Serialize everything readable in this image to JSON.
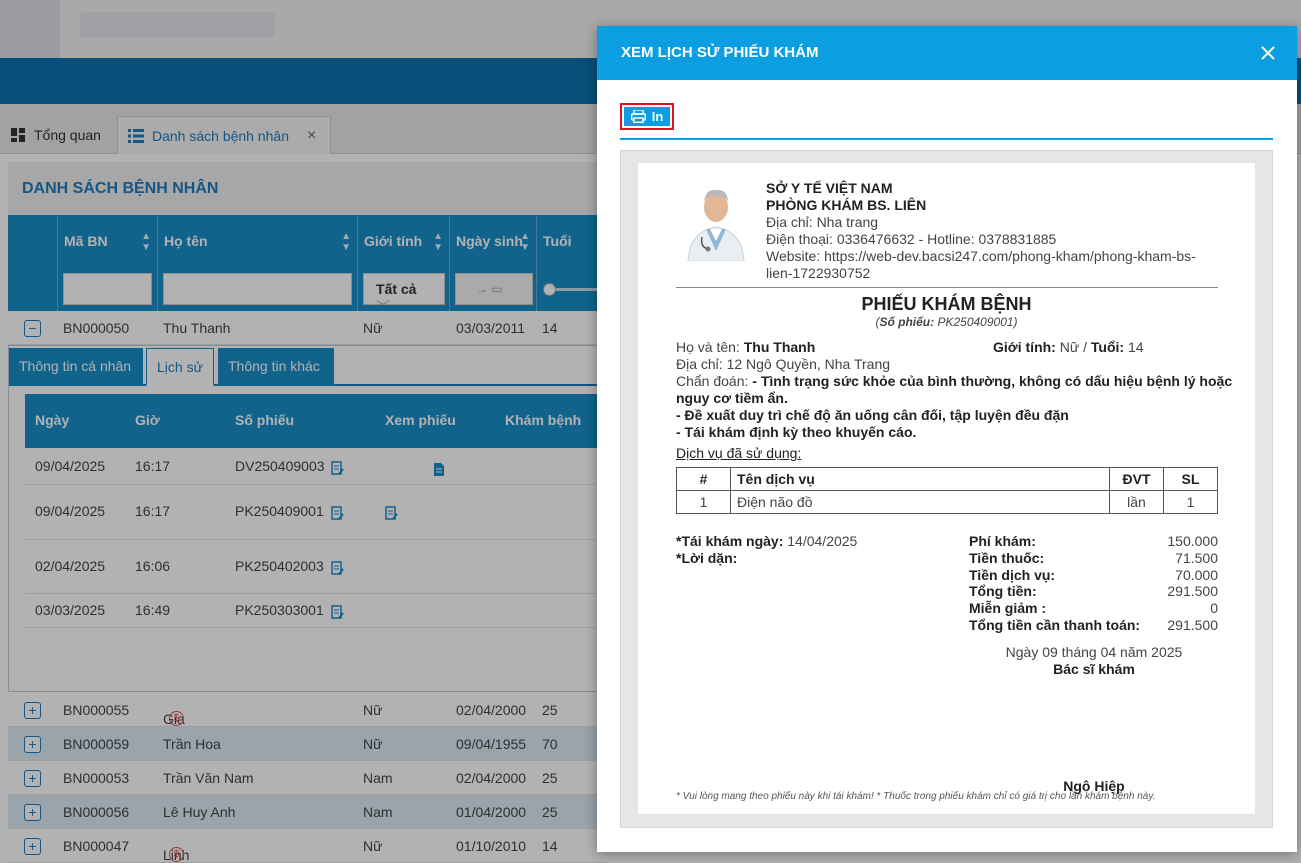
{
  "app": {
    "tabs": [
      {
        "label": "Tổng quan",
        "icon": "dashboard-icon"
      },
      {
        "label": "Danh sách bệnh nhân",
        "icon": "list-icon"
      }
    ],
    "list_title": "DANH SÁCH BỆNH NHÂN",
    "columns": [
      "Mã BN",
      "Họ tên",
      "Giới tính",
      "Ngày sinh",
      "Tuổi"
    ],
    "gender_filter": "Tất cả",
    "date_filter": "→",
    "expanded_patient": {
      "id": "BN000050",
      "name": "Thu Thanh",
      "gender": "Nữ",
      "dob": "03/03/2011",
      "age": "14"
    },
    "detail_tabs": [
      "Thông tin cá nhân",
      "Lịch sử",
      "Thông tin khác"
    ],
    "history_columns": [
      "Ngày",
      "Giờ",
      "Số phiếu",
      "Xem phiếu",
      "Khám bệnh"
    ],
    "history": [
      {
        "date": "09/04/2025",
        "time": "16:17",
        "ticket": "DV250409003"
      },
      {
        "date": "09/04/2025",
        "time": "16:17",
        "ticket": "PK250409001"
      },
      {
        "date": "02/04/2025",
        "time": "16:06",
        "ticket": "PK250402003"
      },
      {
        "date": "03/03/2025",
        "time": "16:49",
        "ticket": "PK250303001"
      }
    ],
    "patients": [
      {
        "id": "BN000055",
        "name": "Gia Hân",
        "gender": "Nữ",
        "dob": "02/04/2000",
        "age": "25",
        "coin": "$"
      },
      {
        "id": "BN000059",
        "name": "Trần Hoa",
        "gender": "Nữ",
        "dob": "09/04/1955",
        "age": "70",
        "coin": ""
      },
      {
        "id": "BN000053",
        "name": "Trần Văn Nam",
        "gender": "Nam",
        "dob": "02/04/2000",
        "age": "25",
        "coin": ""
      },
      {
        "id": "BN000056",
        "name": "Lê Huy Anh",
        "gender": "Nam",
        "dob": "01/04/2000",
        "age": "25",
        "coin": ""
      },
      {
        "id": "BN000047",
        "name": "Linh Na",
        "gender": "Nữ",
        "dob": "01/10/2010",
        "age": "14",
        "coin": "$"
      }
    ]
  },
  "modal": {
    "title": "XEM LỊCH SỬ PHIẾU KHÁM",
    "print_label": "In",
    "sheet": {
      "org": "SỞ Y TẾ VIỆT NAM",
      "clinic": "PHÒNG KHÁM BS. LIÊN",
      "address": "Địa chỉ: Nha trang",
      "phone": "Điện thoại: 0336476632 - Hotline: 0378831885",
      "website_1": "Website: https://web-dev.bacsi247.com/phong-kham/phong-kham-bs-",
      "website_2": "lien-1722930752",
      "title": "PHIẾU KHÁM BỆNH",
      "ticket_label": "Số phiếu:",
      "ticket": "PK250409001",
      "name_label": "Họ và tên:",
      "name": "Thu Thanh",
      "gender_label": "Giới tính:",
      "gender": "Nữ",
      "age_label": "Tuổi:",
      "age": "14",
      "addr_label": "Địa chỉ:",
      "addr": "12 Ngô Quyền, Nha Trang",
      "diag_label": "Chẩn đoán:",
      "diag_1": "- Tình trạng sức khỏe của bình thường, không có dấu hiệu bệnh lý hoặc",
      "diag_2": "nguy cơ tiềm ẩn.",
      "diag_3": "- Đề xuất duy trì chế độ ăn uống cân đối, tập luyện đều đặn",
      "diag_4": "- Tái khám định kỳ theo khuyến cáo.",
      "services_label": "Dịch vụ đã sử dụng:",
      "service_cols": [
        "#",
        "Tên dịch vụ",
        "ĐVT",
        "SL"
      ],
      "services": [
        {
          "no": "1",
          "name": "Điện não đồ",
          "unit": "lần",
          "qty": "1"
        }
      ],
      "revisit_label": "*Tái khám ngày:",
      "revisit": "14/04/2025",
      "advice_label": "*Lời dặn:",
      "fees": [
        {
          "label": "Phí khám:",
          "value": "150.000"
        },
        {
          "label": "Tiền thuốc:",
          "value": "71.500"
        },
        {
          "label": "Tiền dịch vụ:",
          "value": "70.000"
        },
        {
          "label": "Tổng tiền:",
          "value": "291.500"
        },
        {
          "label": "Miễn giảm :",
          "value": "0"
        },
        {
          "label": "Tổng tiền cần thanh toán:",
          "value": "291.500"
        }
      ],
      "date_line": "Ngày 09 tháng 04 năm 2025",
      "doctor_label": "Bác sĩ khám",
      "doctor": "Ngô Hiệp",
      "footnote": "* Vui lòng mang theo phiếu này khi tái khám! * Thuốc trong phiếu khám chỉ có giá trị cho lần khám bệnh này."
    }
  }
}
